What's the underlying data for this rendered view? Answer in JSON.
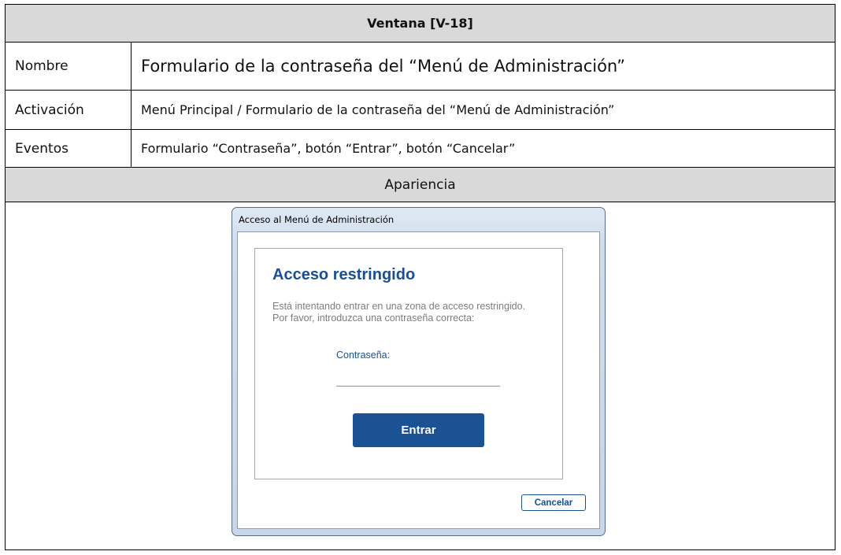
{
  "table": {
    "title": "Ventana [V-18]",
    "rows": [
      {
        "label": "Nombre",
        "value": "Formulario de la contraseña del “Menú de Administración”"
      },
      {
        "label": "Activación",
        "value": "Menú Principal / Formulario de la contraseña del “Menú de Administración”"
      },
      {
        "label": "Eventos",
        "value": "Formulario “Contraseña”, botón “Entrar”, botón “Cancelar”"
      }
    ],
    "appearance_header": "Apariencia"
  },
  "dialog": {
    "window_title": "Acceso al Menú de Administración",
    "heading": "Acceso restringido",
    "description_line1": "Está intentando entrar en una zona de acceso restringido.",
    "description_line2": "Por favor, introduzca una contraseña correcta:",
    "password_label": "Contraseña:",
    "password_value": "",
    "enter_button": "Entrar",
    "cancel_button": "Cancelar"
  },
  "colors": {
    "header_shading": "#d9d9d9",
    "accent_blue": "#1b5294",
    "description_gray": "#7d7d7d"
  }
}
